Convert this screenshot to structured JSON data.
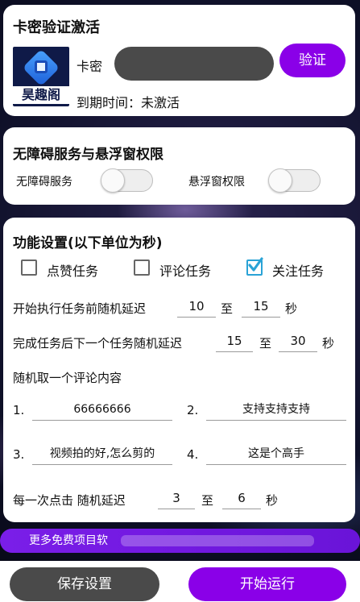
{
  "activation": {
    "title": "卡密验证激活",
    "logo_text": "昊趣阁",
    "key_label": "卡密",
    "verify_label": "验证",
    "expire_label": "到期时间：",
    "expire_value": "未激活"
  },
  "permissions": {
    "title": "无障碍服务与悬浮窗权限",
    "accessibility_label": "无障碍服务",
    "overlay_label": "悬浮窗权限"
  },
  "settings": {
    "title": "功能设置(以下单位为秒)",
    "tasks": [
      {
        "label": "点赞任务",
        "checked": false
      },
      {
        "label": "评论任务",
        "checked": false
      },
      {
        "label": "关注任务",
        "checked": true
      }
    ],
    "start_delay_label": "开始执行任务前随机延迟",
    "start_delay_min": "10",
    "start_delay_to": "至",
    "start_delay_max": "15",
    "start_delay_unit": "秒",
    "next_delay_label": "完成任务后下一个任务随机延迟",
    "next_delay_min": "15",
    "next_delay_to": "至",
    "next_delay_max": "30",
    "next_delay_unit": "秒",
    "comment_label": "随机取一个评论内容",
    "comments": [
      {
        "num": "1.",
        "text": "66666666"
      },
      {
        "num": "2.",
        "text": "支持支持支持"
      },
      {
        "num": "3.",
        "text": "视频拍的好,怎么剪的"
      },
      {
        "num": "4.",
        "text": "这是个高手"
      }
    ],
    "click_delay_label": "每一次点击 随机延迟",
    "click_delay_min": "3",
    "click_delay_to": "至",
    "click_delay_max": "6",
    "click_delay_unit": "秒"
  },
  "banner": {
    "text": "更多免费项目软"
  },
  "actions": {
    "save_label": "保存设置",
    "start_label": "开始运行"
  },
  "colors": {
    "accent": "#8a00e8",
    "dark_pill": "#4a4a4a",
    "check": "#2aa3d6"
  }
}
